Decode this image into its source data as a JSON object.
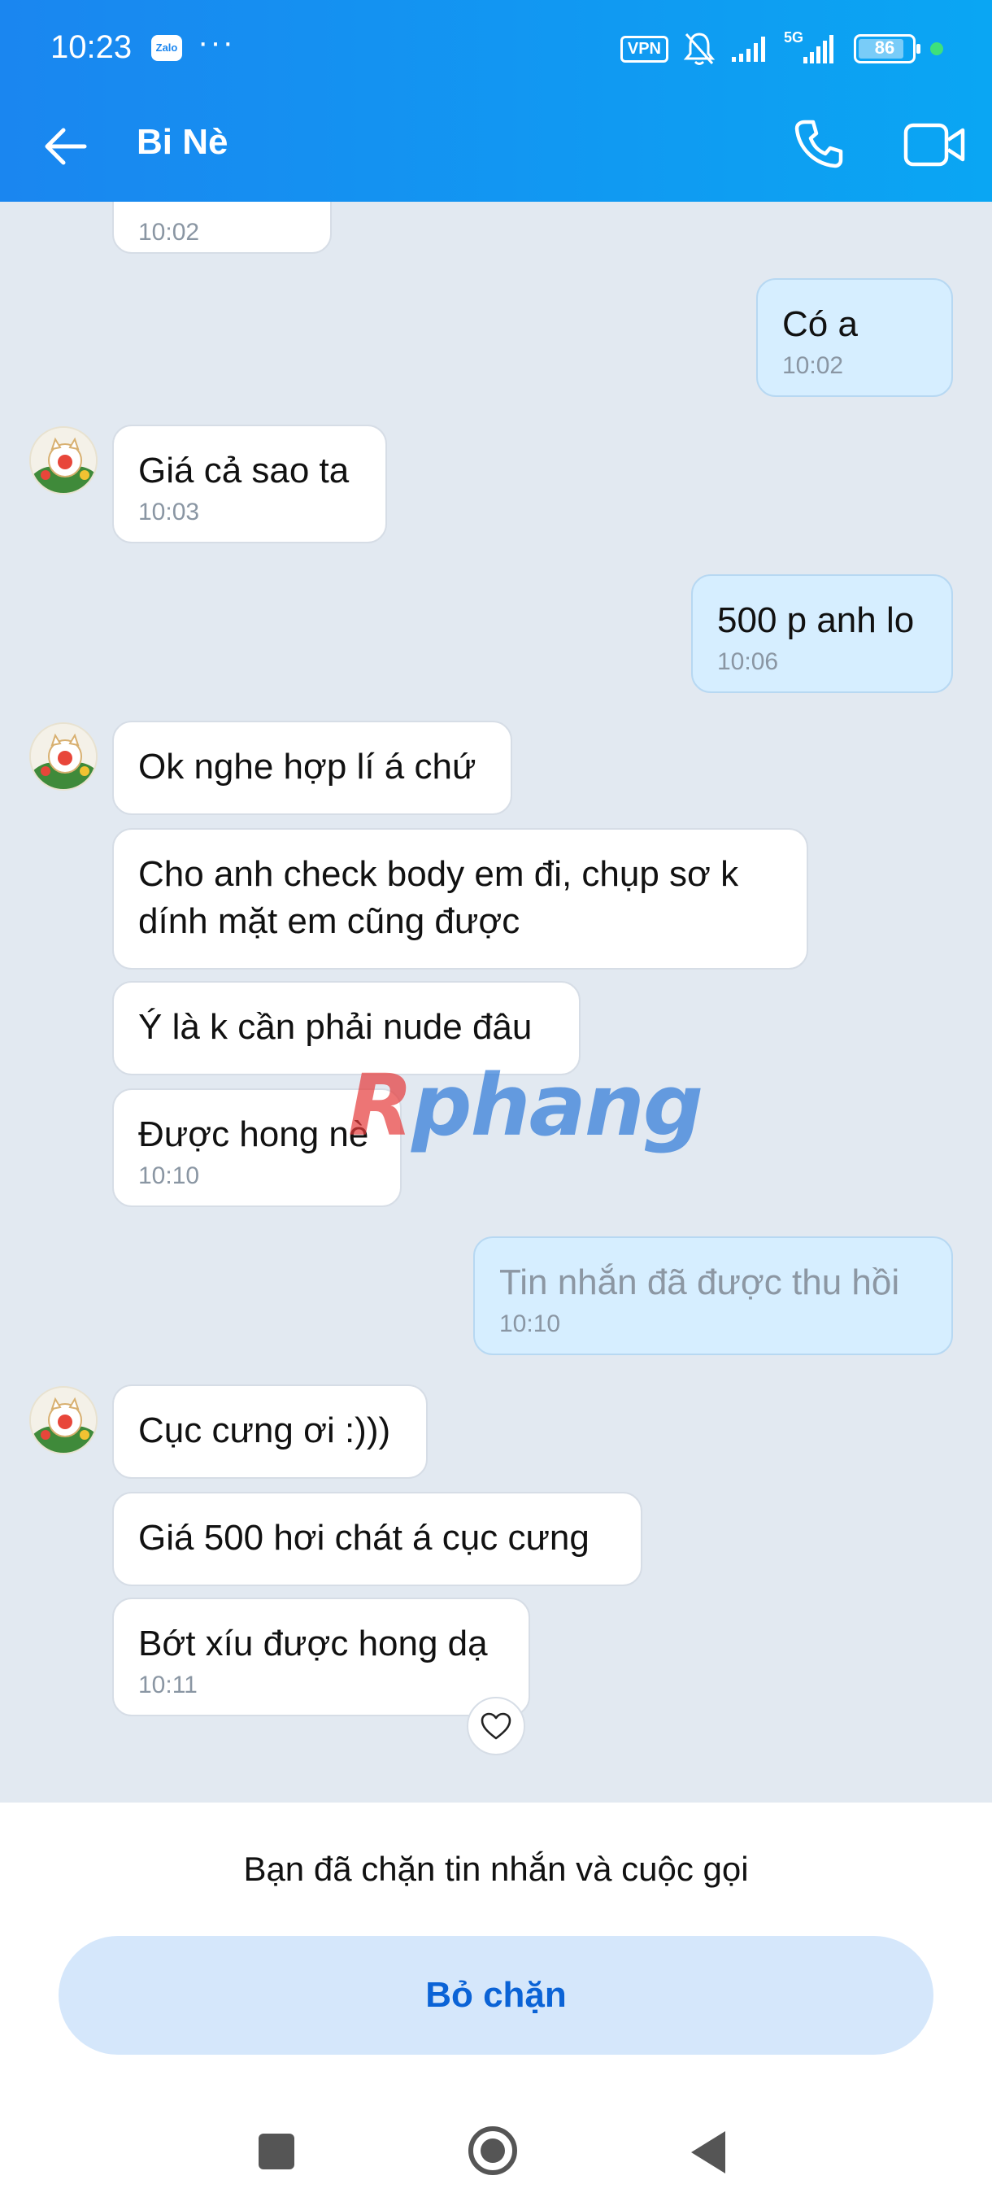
{
  "status_bar": {
    "time": "10:23",
    "zalo_badge": "Zalo",
    "more": "···",
    "vpn": "VPN",
    "network": "5G",
    "battery": "86",
    "battery_level_percent": 86
  },
  "header": {
    "contact_name": "Bi Nè",
    "icons": [
      "back-arrow-icon",
      "phone-icon",
      "video-camera-icon"
    ],
    "colors": {
      "gradient_start": "#1a86f0",
      "gradient_end": "#0aa6f3"
    }
  },
  "messages": [
    {
      "from": "them",
      "text": "",
      "time": "10:02"
    },
    {
      "from": "me",
      "text": "Có a",
      "time": "10:02"
    },
    {
      "from": "them",
      "text": "Giá cả sao ta",
      "time": "10:03"
    },
    {
      "from": "me",
      "text": "500 p anh lo",
      "time": "10:06"
    },
    {
      "from": "them",
      "text": "Ok nghe hợp lí á chứ",
      "time": ""
    },
    {
      "from": "them",
      "text": "Cho anh check body em đi, chụp sơ k dính mặt em cũng được",
      "time": ""
    },
    {
      "from": "them",
      "text": "Ý là k cần phải nude đâu",
      "time": ""
    },
    {
      "from": "them",
      "text": "Được hong nè",
      "time": "10:10"
    },
    {
      "from": "me",
      "text": "Tin nhắn đã được thu hồi",
      "time": "10:10",
      "recalled": true
    },
    {
      "from": "them",
      "text": "Cục cưng ơi :)))",
      "time": ""
    },
    {
      "from": "them",
      "text": "Giá 500 hơi chát á cục cưng",
      "time": ""
    },
    {
      "from": "them",
      "text": "Bớt xíu được hong dạ",
      "time": "10:11"
    }
  ],
  "watermark": {
    "part1": "R",
    "part2": "phang"
  },
  "blocked": {
    "notice": "Bạn đã chặn tin nhắn và cuộc gọi",
    "unblock_label": "Bỏ chặn"
  },
  "colors": {
    "chat_background": "#e2e9f1",
    "outgoing_bubble": "#d6eeff",
    "incoming_bubble": "#ffffff",
    "unblock_text": "#0b63d6"
  }
}
